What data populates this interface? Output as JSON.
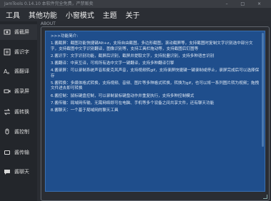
{
  "window": {
    "title": "JamTools 0.14.10 本软件完全免费，严禁贩卖",
    "controls": "– □ ×"
  },
  "menu": {
    "items": [
      "工具",
      "其他功能",
      "小窗模式",
      "主题",
      "关于"
    ]
  },
  "sidebar": {
    "items": [
      {
        "label": "酱截屏",
        "icon": "screenshot-icon"
      },
      {
        "label": "酱识字",
        "icon": "ocr-icon"
      },
      {
        "label": "酱翻译",
        "icon": "translate-icon"
      },
      {
        "label": "酱录屏",
        "icon": "record-icon"
      },
      {
        "label": "酱转换",
        "icon": "convert-icon"
      },
      {
        "label": "酱控制",
        "icon": "control-icon"
      },
      {
        "label": "酱传输",
        "icon": "transfer-icon"
      },
      {
        "label": "酱聊天",
        "icon": "chat-icon"
      }
    ]
  },
  "about": {
    "tab_label": "ABOUT",
    "paragraphs": [
      ">>>功能简介:",
      "1.酱截屏：截图功能快捷键Alt+z，支持自由截图，多边形截图，滚动截屏等，支持截图时复制文字识别选中部分文字，支持截图中文字识别翻译，图像识别等，支持工具栏拖动等，支持截图后钉图等",
      "2.酱识字：文字识别功能，截屏后识别，截屏并提取文字，支持批量识别，支持多种语言识别",
      "3.酱翻译：中英互译，可将所有选中文字一键翻译，支持多种翻译引擎",
      "4.酱录屏：可以录制系统声音和麦克风声音，支持视频转gif，支持录屏快捷键一键录制或停止，录屏完成后可以选择保存",
      "5.酱转换：多媒体格式转换，支持视频、音频、图片等多种格式转换，转换为gif，也可以将一系列图片转为视频；拖拽文件进去即可转换",
      "6.酱控制：鼠标键盘控制，可以录制鼠标键盘动作并重复执行，支持多种控制模式",
      "7.酱传输：局域网传输，无需网络即可在电脑、手机等多个设备之间共享文件，还有聊天功能",
      "8.酱聊天：一个基于局域网的聊天工具"
    ]
  }
}
